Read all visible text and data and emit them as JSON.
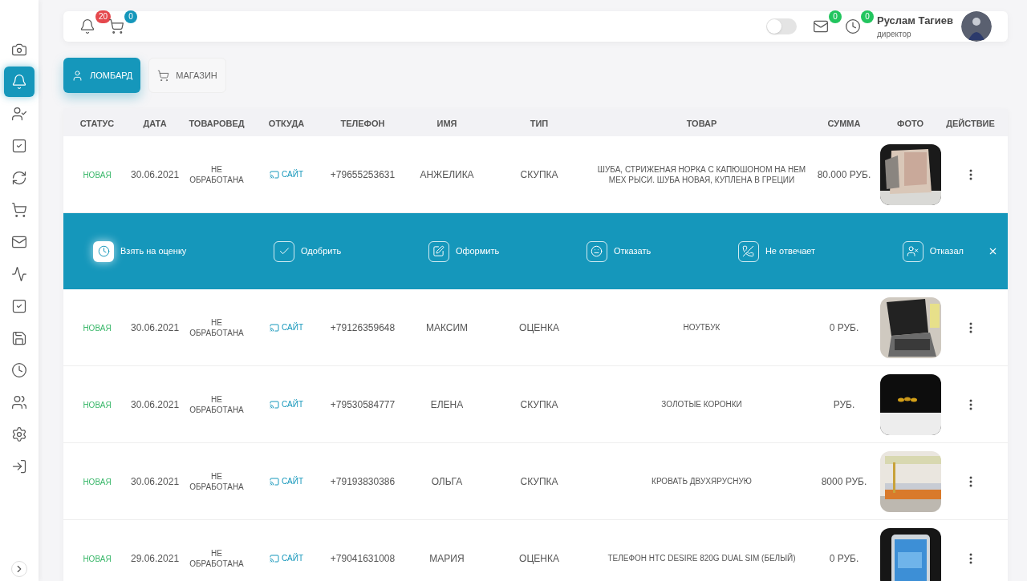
{
  "sidebar": {
    "items": [
      {
        "selected": false
      },
      {
        "selected": true
      },
      {
        "selected": false
      },
      {
        "selected": false
      },
      {
        "selected": false
      },
      {
        "selected": false
      },
      {
        "selected": false
      },
      {
        "selected": false
      },
      {
        "selected": false
      },
      {
        "selected": false
      },
      {
        "selected": false
      },
      {
        "selected": false
      },
      {
        "selected": false
      },
      {
        "selected": false
      }
    ]
  },
  "header": {
    "notifications": "20",
    "cart": "0",
    "theme_toggle": {
      "on": false
    },
    "mail": "0",
    "history": "0",
    "user": {
      "name": "Руслам Тагиев",
      "role": "директор"
    }
  },
  "tabs": [
    {
      "label": "ЛОМБАРД",
      "selected": true
    },
    {
      "label": "МАГАЗИН",
      "selected": false
    }
  ],
  "table": {
    "columns": [
      "СТАТУС",
      "ДАТА",
      "ТОВАРОВЕД",
      "ОТКУДА",
      "ТЕЛЕФОН",
      "ИМЯ",
      "ТИП",
      "ТОВАР",
      "СУММА",
      "ФОТО",
      "ДЕЙСТВИЕ"
    ],
    "rows": [
      {
        "status": "НОВАЯ",
        "date": "30.06.2021",
        "merchandiser": "НЕ ОБРАБОТАНА",
        "source": "САЙТ",
        "phone": "+79655253631",
        "name": "АНЖЕЛИКА",
        "type": "СКУПКА",
        "item": "ШУБА, СТРИЖЕНАЯ НОРКА С КАПЮШОНОМ НА НЕМ МЕХ РЫСИ. ШУБА НОВАЯ, КУПЛЕНА В ГРЕЦИИ",
        "sum": "80.000 РУБ.",
        "expanded": true
      },
      {
        "status": "НОВАЯ",
        "date": "30.06.2021",
        "merchandiser": "НЕ ОБРАБОТАНА",
        "source": "САЙТ",
        "phone": "+79126359648",
        "name": "МАКСИМ",
        "type": "ОЦЕНКА",
        "item": "НОУТБУК",
        "sum": "0 РУБ.",
        "expanded": false
      },
      {
        "status": "НОВАЯ",
        "date": "30.06.2021",
        "merchandiser": "НЕ ОБРАБОТАНА",
        "source": "САЙТ",
        "phone": "+79530584777",
        "name": "ЕЛЕНА",
        "type": "СКУПКА",
        "item": "ЗОЛОТЫЕ КОРОНКИ",
        "sum": "РУБ.",
        "expanded": false
      },
      {
        "status": "НОВАЯ",
        "date": "30.06.2021",
        "merchandiser": "НЕ ОБРАБОТАНА",
        "source": "САЙТ",
        "phone": "+79193830386",
        "name": "ОЛЬГА",
        "type": "СКУПКА",
        "item": "КРОВАТЬ ДВУХЯРУСНУЮ",
        "sum": "8000 РУБ.",
        "expanded": false
      },
      {
        "status": "НОВАЯ",
        "date": "29.06.2021",
        "merchandiser": "НЕ ОБРАБОТАНА",
        "source": "САЙТ",
        "phone": "+79041631008",
        "name": "МАРИЯ",
        "type": "ОЦЕНКА",
        "item": "ТЕЛЕФОН HTC DESIRE 820G DUAL SIM (БЕЛЫЙ)",
        "sum": "0 РУБ.",
        "expanded": false
      }
    ]
  },
  "action_panel": {
    "actions": [
      {
        "label": "Взять на оценку",
        "selected": true
      },
      {
        "label": "Одобрить",
        "selected": false
      },
      {
        "label": "Оформить",
        "selected": false
      },
      {
        "label": "Отказать",
        "selected": false
      },
      {
        "label": "Не отвечает",
        "selected": false
      },
      {
        "label": "Отказал",
        "selected": false
      }
    ]
  }
}
